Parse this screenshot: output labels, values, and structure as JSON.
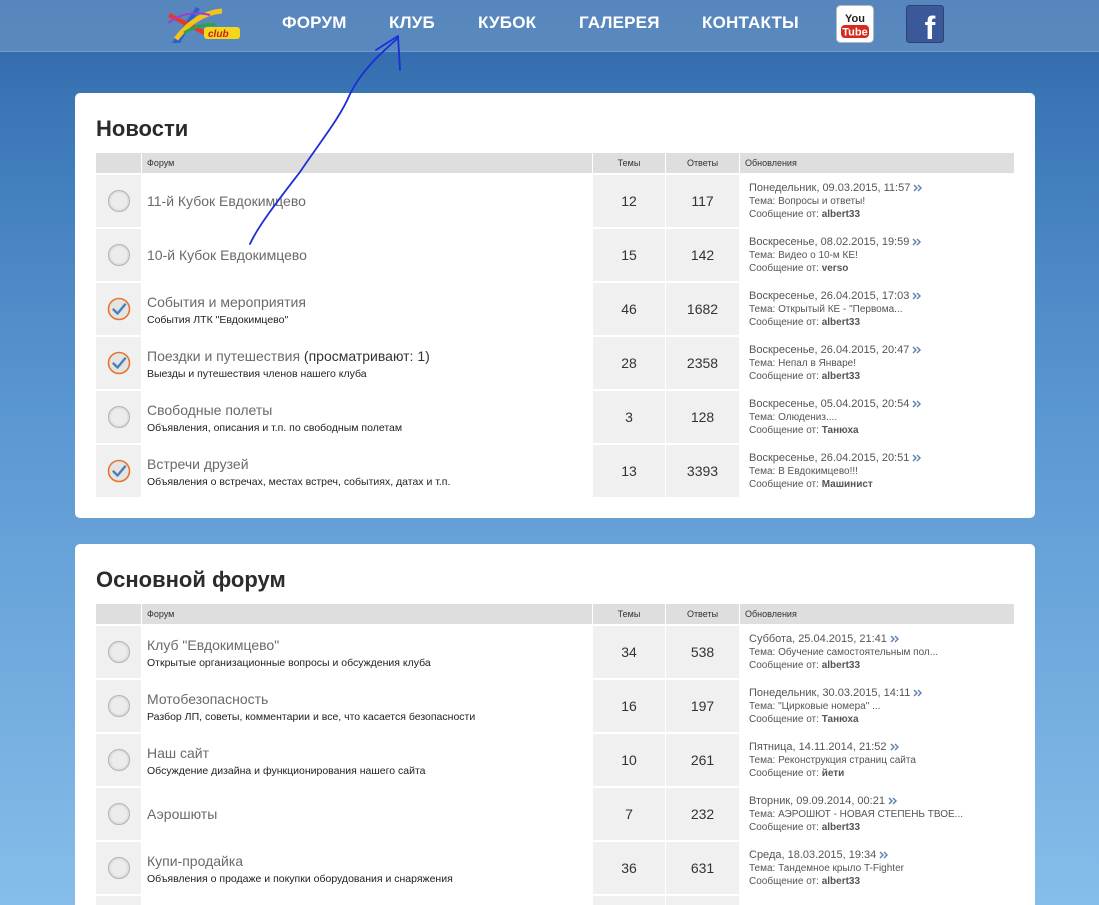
{
  "nav": {
    "logo_text": "club",
    "items": [
      "ФОРУМ",
      "КЛУБ",
      "КУБОК",
      "ГАЛЕРЕЯ",
      "КОНТАКТЫ"
    ],
    "youtube_label": "You Tube",
    "facebook_label": "f"
  },
  "icons": {
    "read": "forum-read-icon",
    "unread": "forum-unread-icon",
    "goto": "goto-last-post-icon"
  },
  "colors": {
    "accent": "#e8732a",
    "title_text": "#2b2b2b",
    "header_bg": "#dedede",
    "youtube_red": "#d62a1e",
    "facebook_blue": "#3b5998"
  },
  "columns": {
    "forum": "Форум",
    "topics": "Темы",
    "replies": "Ответы",
    "updates": "Обновления"
  },
  "sections": [
    {
      "title": "Новости",
      "forums": [
        {
          "name": "11-й Кубок Евдокимцево",
          "viewing": "",
          "desc": "",
          "topics": "12",
          "replies": "117",
          "date": "Понедельник, 09.03.2015, 11:57",
          "topic_prefix": "Тема:",
          "topic": "Вопросы и ответы!",
          "author_prefix": "Сообщение от:",
          "author": "albert33",
          "status": "read"
        },
        {
          "name": "10-й Кубок Евдокимцево",
          "viewing": "",
          "desc": "",
          "topics": "15",
          "replies": "142",
          "date": "Воскресенье, 08.02.2015, 19:59",
          "topic_prefix": "Тема:",
          "topic": "Видео о 10-м КЕ!",
          "author_prefix": "Сообщение от:",
          "author": "verso",
          "status": "read"
        },
        {
          "name": "События и мероприятия",
          "viewing": "",
          "desc": "События ЛТК \"Евдокимцево\"",
          "topics": "46",
          "replies": "1682",
          "date": "Воскресенье, 26.04.2015, 17:03",
          "topic_prefix": "Тема:",
          "topic": "Открытый КЕ - \"Первома...",
          "author_prefix": "Сообщение от:",
          "author": "albert33",
          "status": "unread"
        },
        {
          "name": "Поездки и путешествия",
          "viewing": " (просматривают: 1)",
          "desc": "Выезды и путешествия членов нашего клуба",
          "topics": "28",
          "replies": "2358",
          "date": "Воскресенье, 26.04.2015, 20:47",
          "topic_prefix": "Тема:",
          "topic": "Непал в Январе!",
          "author_prefix": "Сообщение от:",
          "author": "albert33",
          "status": "unread"
        },
        {
          "name": "Свободные полеты",
          "viewing": "",
          "desc": "Объявления, описания и т.п. по свободным полетам",
          "topics": "3",
          "replies": "128",
          "date": "Воскресенье, 05.04.2015, 20:54",
          "topic_prefix": "Тема:",
          "topic": "Олюдениз....",
          "author_prefix": "Сообщение от:",
          "author": "Танюха",
          "status": "read"
        },
        {
          "name": "Встречи друзей",
          "viewing": "",
          "desc": "Объявления о встречах, местах встреч, событиях, датах и т.п.",
          "topics": "13",
          "replies": "3393",
          "date": "Воскресенье, 26.04.2015, 20:51",
          "topic_prefix": "Тема:",
          "topic": "В Евдокимцево!!!",
          "author_prefix": "Сообщение от:",
          "author": "Машинист",
          "status": "unread"
        }
      ]
    },
    {
      "title": "Основной форум",
      "forums": [
        {
          "name": "Клуб \"Евдокимцево\"",
          "viewing": "",
          "desc": "Открытые организационные вопросы и обсуждения клуба",
          "topics": "34",
          "replies": "538",
          "date": "Суббота, 25.04.2015, 21:41",
          "topic_prefix": "Тема:",
          "topic": "Обучение самостоятельным пол...",
          "author_prefix": "Сообщение от:",
          "author": "albert33",
          "status": "read"
        },
        {
          "name": "Мотобезопасность",
          "viewing": "",
          "desc": "Разбор ЛП, советы, комментарии и все, что касается безопасности",
          "topics": "16",
          "replies": "197",
          "date": "Понедельник, 30.03.2015, 14:11",
          "topic_prefix": "Тема:",
          "topic": "\"Цирковые номера\" ...",
          "author_prefix": "Сообщение от:",
          "author": "Танюха",
          "status": "read"
        },
        {
          "name": "Наш сайт",
          "viewing": "",
          "desc": "Обсуждение дизайна и функционирования нашего сайта",
          "topics": "10",
          "replies": "261",
          "date": "Пятница, 14.11.2014, 21:52",
          "topic_prefix": "Тема:",
          "topic": "Реконструкция страниц сайта",
          "author_prefix": "Сообщение от:",
          "author": "йети",
          "status": "read"
        },
        {
          "name": "Аэрошюты",
          "viewing": "",
          "desc": "",
          "topics": "7",
          "replies": "232",
          "date": "Вторник, 09.09.2014, 00:21",
          "topic_prefix": "Тема:",
          "topic": "АЭРОШЮТ - НОВАЯ СТЕПЕНЬ ТВОЕ...",
          "author_prefix": "Сообщение от:",
          "author": "albert33",
          "status": "read"
        },
        {
          "name": "Купи-продайка",
          "viewing": "",
          "desc": "Объявления о продаже и покупки оборудования и снаряжения",
          "topics": "36",
          "replies": "631",
          "date": "Среда, 18.03.2015, 19:34",
          "topic_prefix": "Тема:",
          "topic": "Тандемное крыло T-Fighter",
          "author_prefix": "Сообщение от:",
          "author": "albert33",
          "status": "read"
        },
        {
          "name": "",
          "viewing": "",
          "desc": "",
          "topics": "",
          "replies": "",
          "date": "",
          "topic_prefix": "",
          "topic": "",
          "author_prefix": "",
          "author": "",
          "status": "read"
        }
      ]
    }
  ]
}
